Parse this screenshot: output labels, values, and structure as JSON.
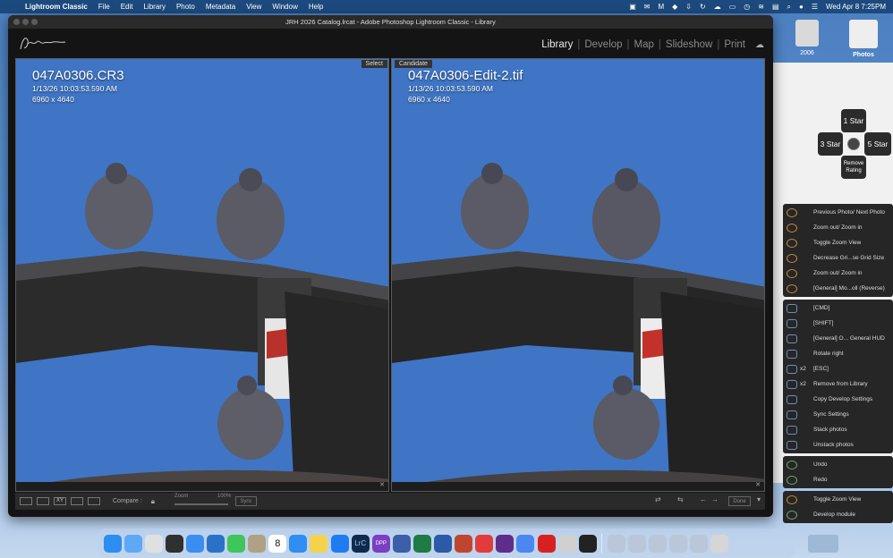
{
  "menubar": {
    "app": "Lightroom Classic",
    "items": [
      "File",
      "Edit",
      "Library",
      "Photo",
      "Metadata",
      "View",
      "Window",
      "Help"
    ],
    "clock": "Wed Apr 8  7:25PM"
  },
  "window": {
    "title": "JRH 2026 Catalog.lrcat - Adobe Photoshop Lightroom Classic - Library",
    "modules": [
      "Library",
      "Develop",
      "Map",
      "Slideshow",
      "Print"
    ],
    "active_module": "Library"
  },
  "left_photo": {
    "tag": "Select",
    "filename": "047A0306.CR3",
    "datetime": "1/13/26 10:03:53.590 AM",
    "dimensions": "6960 x 4640"
  },
  "right_photo": {
    "tag": "Candidate",
    "filename": "047A0306-Edit-2.tif",
    "datetime": "1/13/26 10:03:53.590 AM",
    "dimensions": "6960 x 4640"
  },
  "toolbar": {
    "xy_label": "XY",
    "compare_label": "Compare :",
    "zoom_label": "Zoom",
    "zoom_value": "100%",
    "sync_label": "Sync",
    "done_label": "Done"
  },
  "desktop": {
    "folder_label": "2006",
    "photos_label": "Photos"
  },
  "rating_menu": {
    "top": "1 Star",
    "left": "3 Star",
    "right": "5 Star",
    "bottom": "Remove Rating"
  },
  "hud": {
    "group1": [
      {
        "mod": "",
        "label": "Previous Photo/ Next Photo"
      },
      {
        "mod": "",
        "label": "Zoom out/ Zoom in"
      },
      {
        "mod": "",
        "label": "Toggle Zoom View"
      },
      {
        "mod": "",
        "label": "Decrease Gri...se Grid Size"
      },
      {
        "mod": "",
        "label": "Zoom out/ Zoom in"
      },
      {
        "mod": "",
        "label": "[General] Mo...oll (Reverse)"
      }
    ],
    "group2": [
      {
        "mod": "",
        "label": "[CMD]"
      },
      {
        "mod": "",
        "label": "[SHIFT]"
      },
      {
        "mod": "",
        "label": "[General] O... General HUD"
      },
      {
        "mod": "",
        "label": "Rotate right"
      },
      {
        "mod": "x2",
        "label": "[ESC]"
      },
      {
        "mod": "x2",
        "label": "Remove from Library"
      },
      {
        "mod": "",
        "label": "Copy Develop Settings"
      },
      {
        "mod": "",
        "label": "Sync Settings"
      },
      {
        "mod": "",
        "label": "Stack photos"
      },
      {
        "mod": "",
        "label": "Unstack photos"
      }
    ],
    "group3": [
      {
        "mod": "",
        "label": "Undo"
      },
      {
        "mod": "",
        "label": "Redo"
      }
    ],
    "group4": [
      {
        "mod": "",
        "label": "Toggle Zoom View"
      },
      {
        "mod": "",
        "label": "Develop module"
      }
    ]
  },
  "dock": {
    "apps": [
      "finder",
      "icloud",
      "launchpad",
      "mission-control",
      "mail",
      "outlook",
      "messages",
      "contacts",
      "calendar",
      "safari",
      "notes",
      "app-store-alt",
      "lightroom-classic",
      "dpp",
      "bbedit",
      "excel",
      "word",
      "powerpoint",
      "news",
      "affinity",
      "google",
      "acrobat",
      "lambda",
      "toolbox"
    ],
    "calendar_day": "8",
    "app_labels": {
      "lightroom": "LrC",
      "dpp": "DPP"
    }
  },
  "colors": {
    "menubar": "#1d4a7e",
    "sky": "#3f75c4",
    "lr_background": "#141414"
  }
}
